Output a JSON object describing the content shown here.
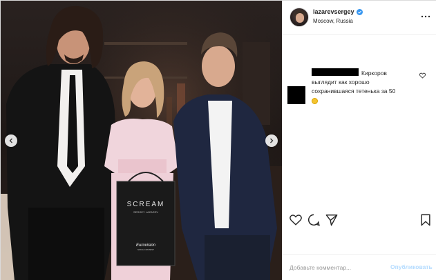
{
  "post": {
    "username": "lazarevsergey",
    "location": "Moscow, Russia",
    "verified": true
  },
  "photo": {
    "bag_brand": "SCREAM",
    "bag_subtitle": "SERGEY LAZAREV",
    "bag_logo": "Eurovision",
    "bag_logo_sub": "SONG CONTEST"
  },
  "comment": {
    "line1": "Киркоров",
    "line2": "выглядит как хорошо",
    "line3": "сохранившаяся тетенька за 50"
  },
  "add_comment": {
    "placeholder": "Добавьте комментар...",
    "post_label": "Опубликовать"
  },
  "colors": {
    "verified_blue": "#3897f0",
    "post_button_disabled": "#b3dbff",
    "text": "#262626"
  },
  "icons": {
    "like": "heart-icon",
    "comment": "comment-bubble-icon",
    "share": "paper-plane-icon",
    "save": "bookmark-icon",
    "more": "ellipsis-icon"
  }
}
